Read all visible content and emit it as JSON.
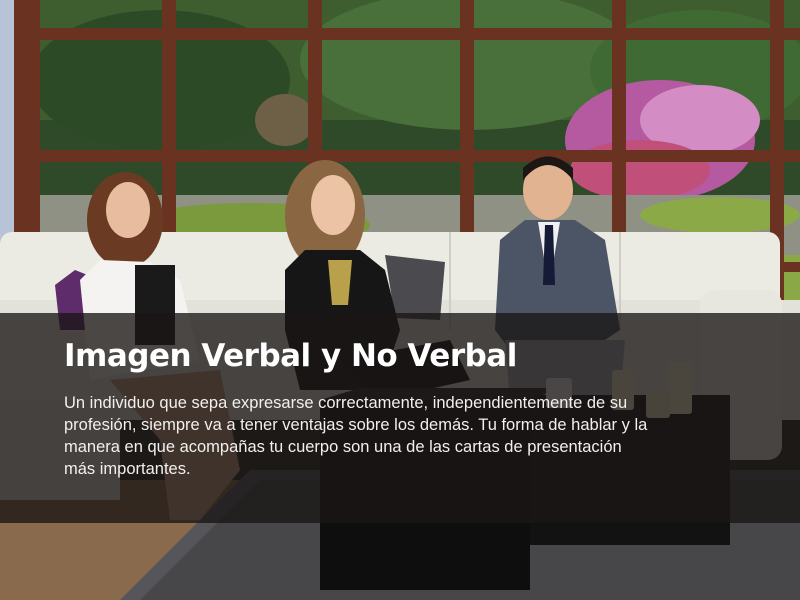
{
  "caption": {
    "title": "Imagen Verbal y No Verbal",
    "body": "Un individuo que sepa expresarse correctamente, independientemente de su profesión, siempre  va a tener ventajas sobre los demás. Tu forma de hablar y la manera en que acompañas tu cuerpo son una de las cartas de presentación más importantes."
  }
}
